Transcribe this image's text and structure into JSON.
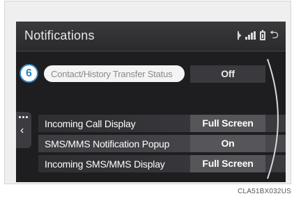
{
  "header": {
    "title": "Notifications",
    "icons": [
      "bluetooth-icon",
      "signal-icon",
      "battery-icon",
      "back-icon"
    ]
  },
  "rows": [
    {
      "badge": "6",
      "label": "Contact/History Transfer Status",
      "value": "Off"
    },
    {
      "label": "Incoming Call Display",
      "value": "Full Screen"
    },
    {
      "label": "SMS/MMS Notification Popup",
      "value": "On"
    },
    {
      "label": "Incoming SMS/MMS Display",
      "value": "Full Screen"
    }
  ],
  "caption": "CLA51BX032US",
  "colors": {
    "badge_border": "#2f84c6",
    "screen_bg": "#1e1e20",
    "value_bg": "#55555a"
  }
}
